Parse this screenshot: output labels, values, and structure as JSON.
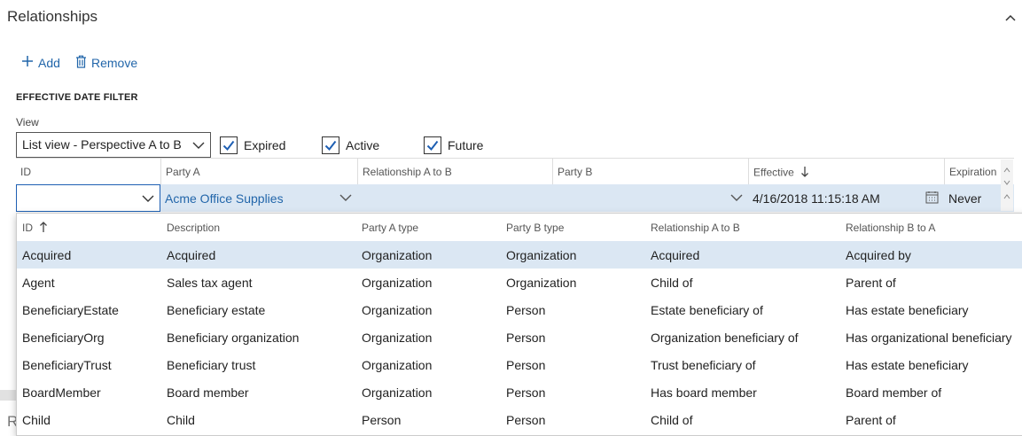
{
  "section": {
    "title": "Relationships"
  },
  "toolbar": {
    "add_label": "Add",
    "remove_label": "Remove"
  },
  "filter": {
    "title": "EFFECTIVE DATE FILTER",
    "view_label": "View",
    "view_value": "List view - Perspective A to B",
    "checkboxes": [
      {
        "label": "Expired",
        "checked": true
      },
      {
        "label": "Active",
        "checked": true
      },
      {
        "label": "Future",
        "checked": true
      }
    ]
  },
  "grid": {
    "columns": [
      "ID",
      "Party A",
      "Relationship A to B",
      "Party B",
      "Effective",
      "Expiration"
    ],
    "edit_row": {
      "id": "",
      "party_a": "Acme Office Supplies",
      "relationship": "",
      "party_b": "",
      "effective": "4/16/2018 11:15:18 AM",
      "expiration": "Never"
    }
  },
  "dropdown": {
    "columns": [
      "ID",
      "Description",
      "Party A type",
      "Party B type",
      "Relationship A to B",
      "Relationship B to A"
    ],
    "rows": [
      [
        "Acquired",
        "Acquired",
        "Organization",
        "Organization",
        "Acquired",
        "Acquired by"
      ],
      [
        "Agent",
        "Sales tax agent",
        "Organization",
        "Organization",
        "Child of",
        "Parent of"
      ],
      [
        "BeneficiaryEstate",
        "Beneficiary estate",
        "Organization",
        "Person",
        "Estate beneficiary of",
        "Has estate beneficiary"
      ],
      [
        "BeneficiaryOrg",
        "Beneficiary organization",
        "Organization",
        "Person",
        "Organization beneficiary of",
        "Has organizational beneficiary"
      ],
      [
        "BeneficiaryTrust",
        "Beneficiary trust",
        "Organization",
        "Person",
        "Trust beneficiary of",
        "Has estate beneficiary"
      ],
      [
        "BoardMember",
        "Board member",
        "Organization",
        "Person",
        "Has board member",
        "Board member of"
      ],
      [
        "Child",
        "Child",
        "Person",
        "Person",
        "Child of",
        "Parent of"
      ]
    ],
    "selected_index": 0
  },
  "behind": {
    "letter": "R"
  },
  "colors": {
    "accent": "#2266aa",
    "selection": "#dbe7f3",
    "focus": "#1e5fb3"
  }
}
